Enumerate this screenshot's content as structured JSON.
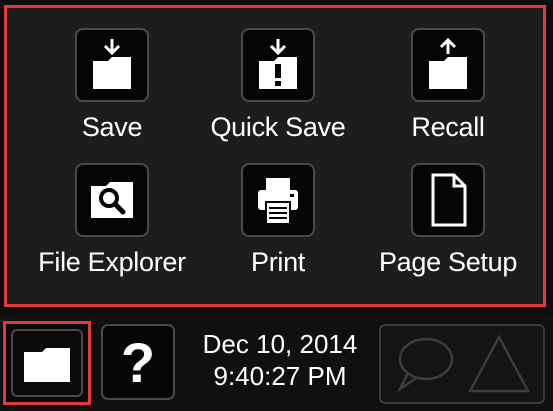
{
  "menu": {
    "items": [
      {
        "label": "Save",
        "icon": "save-folder-icon"
      },
      {
        "label": "Quick Save",
        "icon": "quick-save-folder-icon"
      },
      {
        "label": "Recall",
        "icon": "recall-folder-icon"
      },
      {
        "label": "File Explorer",
        "icon": "file-explorer-icon"
      },
      {
        "label": "Print",
        "icon": "printer-icon"
      },
      {
        "label": "Page Setup",
        "icon": "page-icon"
      }
    ]
  },
  "taskbar": {
    "folder_icon": "folder-icon",
    "help_icon": "question-mark-icon",
    "date": "Dec 10, 2014",
    "time": "9:40:27 PM",
    "notification_icons": [
      "message-bubble-icon",
      "warning-triangle-icon"
    ]
  },
  "colors": {
    "highlight": "#e03a3a",
    "panel_bg": "#1d1d1d",
    "text": "#ffffff"
  }
}
